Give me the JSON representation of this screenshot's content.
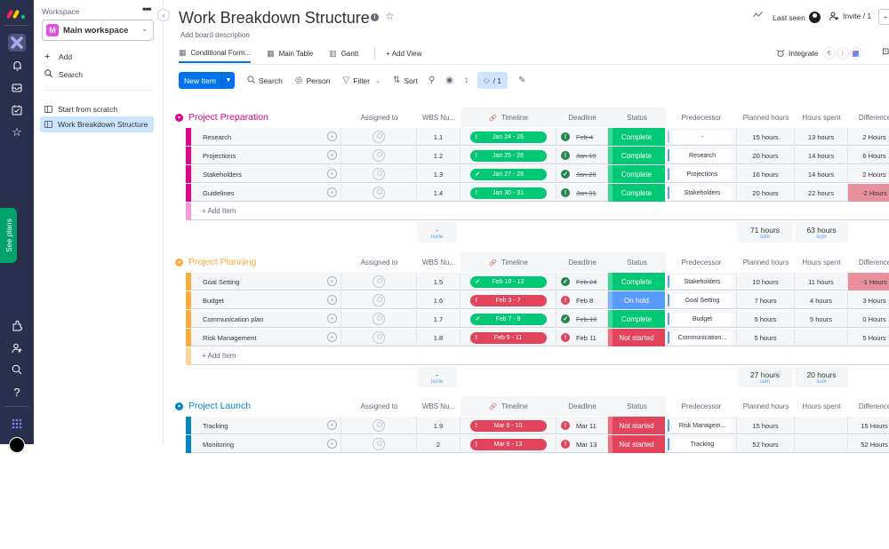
{
  "rail": {
    "icons": [
      "monday-logo",
      "workspaces-icon",
      "bell-icon",
      "inbox-icon",
      "my-work-icon",
      "favorites-icon",
      "apps-icon",
      "invite-icon",
      "search-icon",
      "help-icon",
      "grid-menu-icon"
    ],
    "see_plans": "See plans"
  },
  "sidebar": {
    "workspace_label": "Workspace",
    "workspace_name": "Main workspace",
    "workspace_initial": "M",
    "add": "Add",
    "search": "Search",
    "boards": [
      {
        "label": "Start from scratch",
        "selected": false
      },
      {
        "label": "Work Breakdown Structure",
        "selected": true
      }
    ]
  },
  "header": {
    "title": "Work Breakdown Structure",
    "description": "Add board description",
    "last_seen": "Last seen",
    "invite": "Invite / 1",
    "integrate": "Integrate"
  },
  "tabs": [
    {
      "label": "Conditional Form...",
      "active": true
    },
    {
      "label": "Main Table",
      "active": false
    },
    {
      "label": "Gantt",
      "active": false
    }
  ],
  "add_view": "+ Add View",
  "toolbar": {
    "new_item": "New Item",
    "search": "Search",
    "person": "Person",
    "filter": "Filter",
    "sort": "Sort",
    "color_rules": "/ 1"
  },
  "columns": {
    "assigned": "Assigned to",
    "wbs": "WBS Nu...",
    "timeline": "Timeline",
    "deadline": "Deadline",
    "status": "Status",
    "predecessor": "Predecessor",
    "planned": "Planned hours",
    "spent": "Hours spent",
    "difference": "Difference"
  },
  "add_item": "+ Add Item",
  "add_label": "Add",
  "colors": {
    "green": "#00c875",
    "red": "#e2445c",
    "blue": "#579bfc",
    "dark_green": "#258750",
    "diff_negative": "#e8919c"
  },
  "groups": [
    {
      "name": "Project Preparation",
      "color": "#e2008c",
      "light": "#f59bd5",
      "rows": [
        {
          "name": "Research",
          "wbs": "1.1",
          "timeline": "Jan 24 - 26",
          "tl_state": "green",
          "tl_icon": "!",
          "dl_icon": "!",
          "dl_icon_color": "#258750",
          "deadline": "Feb 4",
          "dl_strike": true,
          "status": "Complete",
          "status_color": "#00c875",
          "pred": "-",
          "planned": "15 hours",
          "spent": "13 hours",
          "diff": "2 Hours",
          "diff_neg": false
        },
        {
          "name": "Projections",
          "wbs": "1.2",
          "timeline": "Jan 25 - 26",
          "tl_state": "green",
          "tl_icon": "!",
          "dl_icon": "!",
          "dl_icon_color": "#258750",
          "deadline": "Jan 19",
          "dl_strike": true,
          "status": "Complete",
          "status_color": "#00c875",
          "pred": "Research",
          "planned": "20 hours",
          "spent": "14 hours",
          "diff": "6 Hours",
          "diff_neg": false
        },
        {
          "name": "Stakeholders",
          "wbs": "1.3",
          "timeline": "Jan 27 - 28",
          "tl_state": "green",
          "tl_icon": "✓",
          "dl_icon": "✓",
          "dl_icon_color": "#258750",
          "deadline": "Jan 28",
          "dl_strike": true,
          "status": "Complete",
          "status_color": "#00c875",
          "pred": "Projections",
          "planned": "16 hours",
          "spent": "14 hours",
          "diff": "2 Hours",
          "diff_neg": false
        },
        {
          "name": "Guidelines",
          "wbs": "1.4",
          "timeline": "Jan 30 - 31",
          "tl_state": "green",
          "tl_icon": "!",
          "dl_icon": "!",
          "dl_icon_color": "#258750",
          "deadline": "Jan 31",
          "dl_strike": true,
          "status": "Complete",
          "status_color": "#00c875",
          "pred": "Stakeholders",
          "planned": "20 hours",
          "spent": "22 hours",
          "diff": "-2 Hours",
          "diff_neg": true
        }
      ],
      "wbs_summary": "-",
      "wbs_summary_label": "none",
      "planned_sum": "71 hours",
      "spent_sum": "63 hours",
      "sum_label": "sum"
    },
    {
      "name": "Project Planning",
      "color": "#fdab3d",
      "light": "#fdd49e",
      "rows": [
        {
          "name": "Goal Setting",
          "wbs": "1.5",
          "timeline": "Feb 10 - 13",
          "tl_state": "green",
          "tl_icon": "✓",
          "dl_icon": "✓",
          "dl_icon_color": "#258750",
          "deadline": "Feb 24",
          "dl_strike": true,
          "status": "Complete",
          "status_color": "#00c875",
          "pred": "Stakeholders",
          "planned": "10 hours",
          "spent": "11 hours",
          "diff": "-1 Hours",
          "diff_neg": true
        },
        {
          "name": "Budget",
          "wbs": "1.6",
          "timeline": "Feb 3 - 7",
          "tl_state": "red",
          "tl_icon": "!",
          "dl_icon": "!",
          "dl_icon_color": "#e2445c",
          "deadline": "Feb 8",
          "dl_strike": false,
          "status": "On hold",
          "status_color": "#579bfc",
          "pred": "Goal Setting",
          "planned": "7 hours",
          "spent": "4 hours",
          "diff": "3 Hours",
          "diff_neg": false
        },
        {
          "name": "Communication plan",
          "wbs": "1.7",
          "timeline": "Feb 7 - 9",
          "tl_state": "green",
          "tl_icon": "✓",
          "dl_icon": "✓",
          "dl_icon_color": "#258750",
          "deadline": "Feb 10",
          "dl_strike": true,
          "status": "Complete",
          "status_color": "#00c875",
          "pred": "Budget",
          "planned": "5 hours",
          "spent": "5 hours",
          "diff": "0 Hours",
          "diff_neg": false
        },
        {
          "name": "Risk Management",
          "wbs": "1.8",
          "timeline": "Feb 9 - 11",
          "tl_state": "red",
          "tl_icon": "!",
          "dl_icon": "!",
          "dl_icon_color": "#e2445c",
          "deadline": "Feb 11",
          "dl_strike": false,
          "status": "Not started",
          "status_color": "#e2445c",
          "pred": "Communication...",
          "planned": "5 hours",
          "spent": "",
          "diff": "5 Hours",
          "diff_neg": false
        }
      ],
      "wbs_summary": "-",
      "wbs_summary_label": "none",
      "planned_sum": "27 hours",
      "spent_sum": "20 hours",
      "sum_label": "sum"
    },
    {
      "name": "Project Launch",
      "color": "#0086c0",
      "light": "#66b6d9",
      "rows": [
        {
          "name": "Tracking",
          "wbs": "1.9",
          "timeline": "Mar 6 - 10",
          "tl_state": "red",
          "tl_icon": "!",
          "dl_icon": "!",
          "dl_icon_color": "#e2445c",
          "deadline": "Mar 11",
          "dl_strike": false,
          "status": "Not started",
          "status_color": "#e2445c",
          "pred": "Risk Managem...",
          "planned": "15 hours",
          "spent": "",
          "diff": "15 Hours",
          "diff_neg": false
        },
        {
          "name": "Monitoring",
          "wbs": "2",
          "timeline": "Mar 9 - 13",
          "tl_state": "red",
          "tl_icon": "!",
          "dl_icon": "!",
          "dl_icon_color": "#e2445c",
          "deadline": "Mar 13",
          "dl_strike": false,
          "status": "Not started",
          "status_color": "#e2445c",
          "pred": "Tracking",
          "planned": "52 hours",
          "spent": "",
          "diff": "52 Hours",
          "diff_neg": false
        }
      ]
    }
  ]
}
